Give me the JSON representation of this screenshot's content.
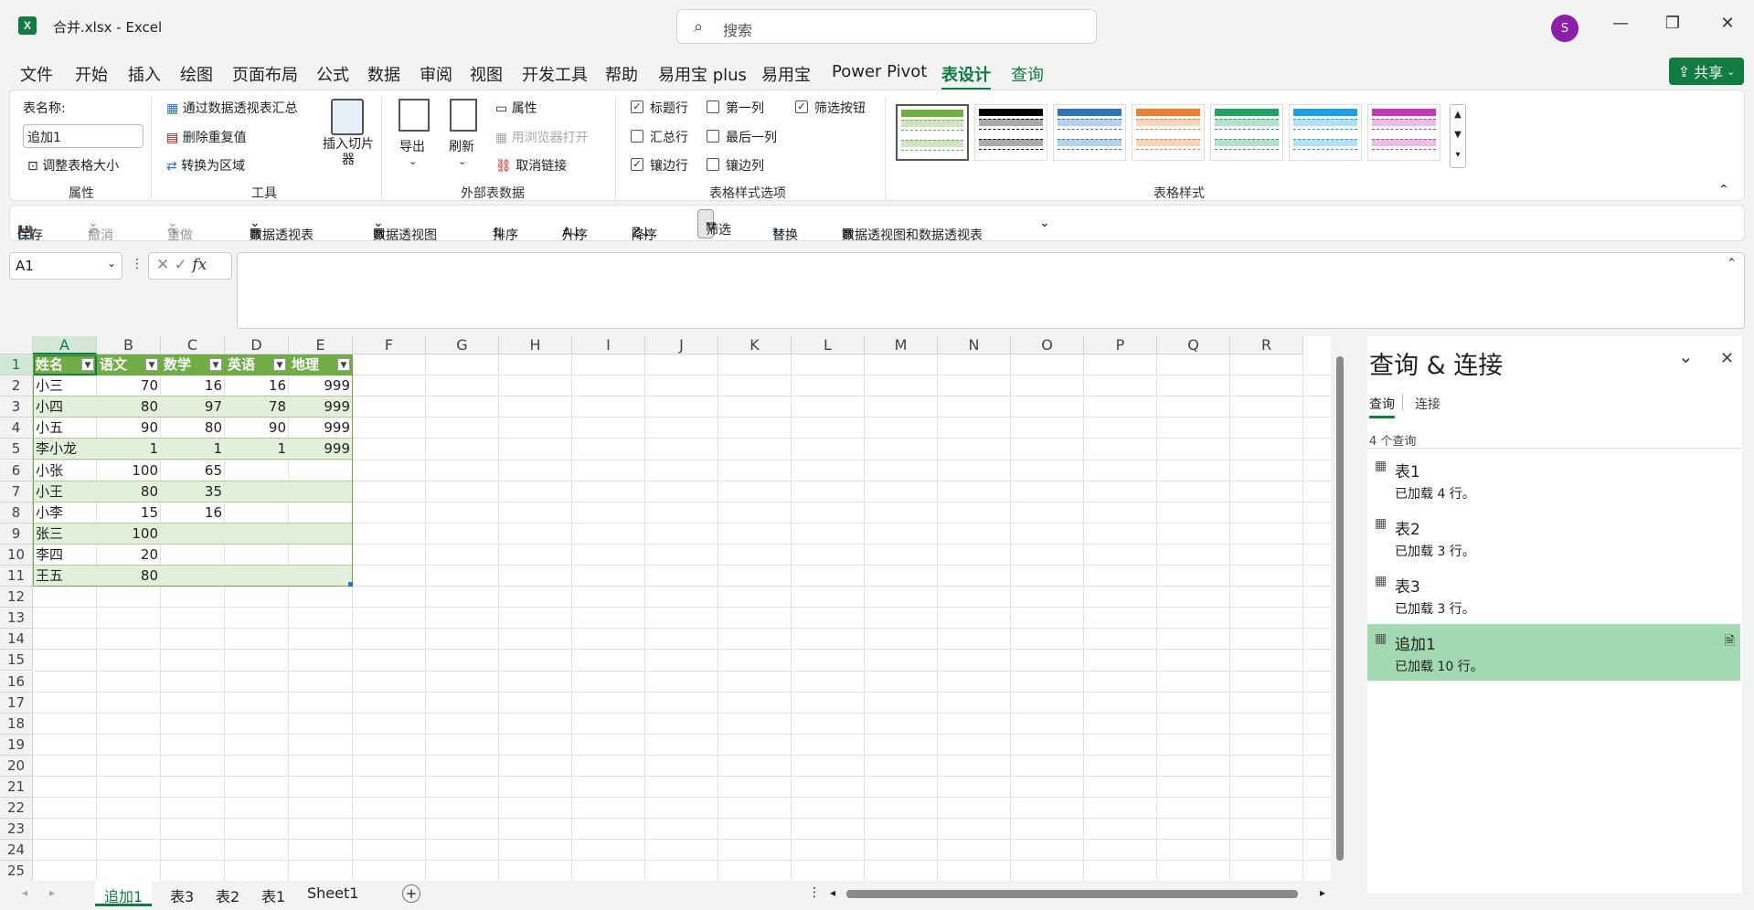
{
  "app": {
    "logo": "X",
    "title": "合并.xlsx  -  Excel",
    "avatar": "S",
    "search_placeholder": "搜索"
  },
  "menu": [
    "文件",
    "开始",
    "插入",
    "绘图",
    "页面布局",
    "公式",
    "数据",
    "审阅",
    "视图",
    "开发工具",
    "帮助",
    "易用宝 plus",
    "易用宝",
    "Power Pivot",
    "表设计",
    "查询"
  ],
  "share_label": "共享",
  "ribbon": {
    "properties": {
      "table_name_label": "表名称:",
      "table_name_value": "追加1",
      "resize_label": "调整表格大小",
      "group_label": "属性"
    },
    "tools": {
      "pivot_summary": "通过数据透视表汇总",
      "remove_duplicates": "删除重复值",
      "convert_to_range": "转换为区域",
      "insert_slicer": "插入切片器",
      "group_label": "工具"
    },
    "external": {
      "export": "导出",
      "refresh": "刷新",
      "properties": "属性",
      "open_browser": "用浏览器打开",
      "unlink": "取消链接",
      "group_label": "外部表数据"
    },
    "style_options": {
      "header_row": "标题行",
      "total_row": "汇总行",
      "banded_rows": "镶边行",
      "first_column": "第一列",
      "last_column": "最后一列",
      "banded_columns": "镶边列",
      "filter_button": "筛选按钮",
      "group_label": "表格样式选项"
    },
    "styles": {
      "group_label": "表格样式",
      "swatch_colors": [
        "#70ad47",
        "#000000",
        "#2e75b6",
        "#ed7d31",
        "#21a366",
        "#1ba1e2",
        "#c239b3"
      ]
    }
  },
  "qat": {
    "save": "保存",
    "undo": "撤消",
    "redo": "重做",
    "pivot_table": "数据透视表",
    "pivot_chart": "数据透视图",
    "sort": "排序",
    "sort_asc": "升序",
    "sort_desc": "降序",
    "filter": "筛选",
    "replace": "替换",
    "pivot_chart_table": "数据透视图和数据透视表"
  },
  "formula_bar": {
    "name_box": "A1",
    "fx": "fx",
    "value": ""
  },
  "sheet": {
    "columns": [
      "A",
      "B",
      "C",
      "D",
      "E",
      "F",
      "G",
      "H",
      "I",
      "J",
      "K",
      "L",
      "M",
      "N",
      "O",
      "P",
      "Q",
      "R"
    ],
    "row_numbers": [
      "1",
      "2",
      "3",
      "4",
      "5",
      "6",
      "7",
      "8",
      "9",
      "10",
      "11",
      "12",
      "13",
      "14",
      "15",
      "16",
      "17",
      "18",
      "19",
      "20",
      "21",
      "22",
      "23",
      "24",
      "25"
    ],
    "headers": [
      "姓名",
      "语文",
      "数学",
      "英语",
      "地理"
    ],
    "rows": [
      [
        "小三",
        "70",
        "16",
        "16",
        "999"
      ],
      [
        "小四",
        "80",
        "97",
        "78",
        "999"
      ],
      [
        "小五",
        "90",
        "80",
        "90",
        "999"
      ],
      [
        "李小龙",
        "1",
        "1",
        "1",
        "999"
      ],
      [
        "小张",
        "100",
        "65",
        "",
        ""
      ],
      [
        "小王",
        "80",
        "35",
        "",
        ""
      ],
      [
        "小李",
        "15",
        "16",
        "",
        ""
      ],
      [
        "张三",
        "100",
        "",
        "",
        ""
      ],
      [
        "李四",
        "20",
        "",
        "",
        ""
      ],
      [
        "王五",
        "80",
        "",
        "",
        ""
      ]
    ]
  },
  "sheet_tabs": [
    "追加1",
    "表3",
    "表2",
    "表1",
    "Sheet1"
  ],
  "pane": {
    "title": "查询 & 连接",
    "tabs": [
      "查询",
      "连接"
    ],
    "count": "4 个查询",
    "queries": [
      {
        "name": "表1",
        "status": "已加载 4 行。"
      },
      {
        "name": "表2",
        "status": "已加载 3 行。"
      },
      {
        "name": "表3",
        "status": "已加载 3 行。"
      },
      {
        "name": "追加1",
        "status": "已加载 10 行。"
      }
    ]
  },
  "colors": {
    "accent": "#107c41",
    "table_header": "#70ad47",
    "band": "#e2efda",
    "selected_query": "#a3d9b1"
  }
}
